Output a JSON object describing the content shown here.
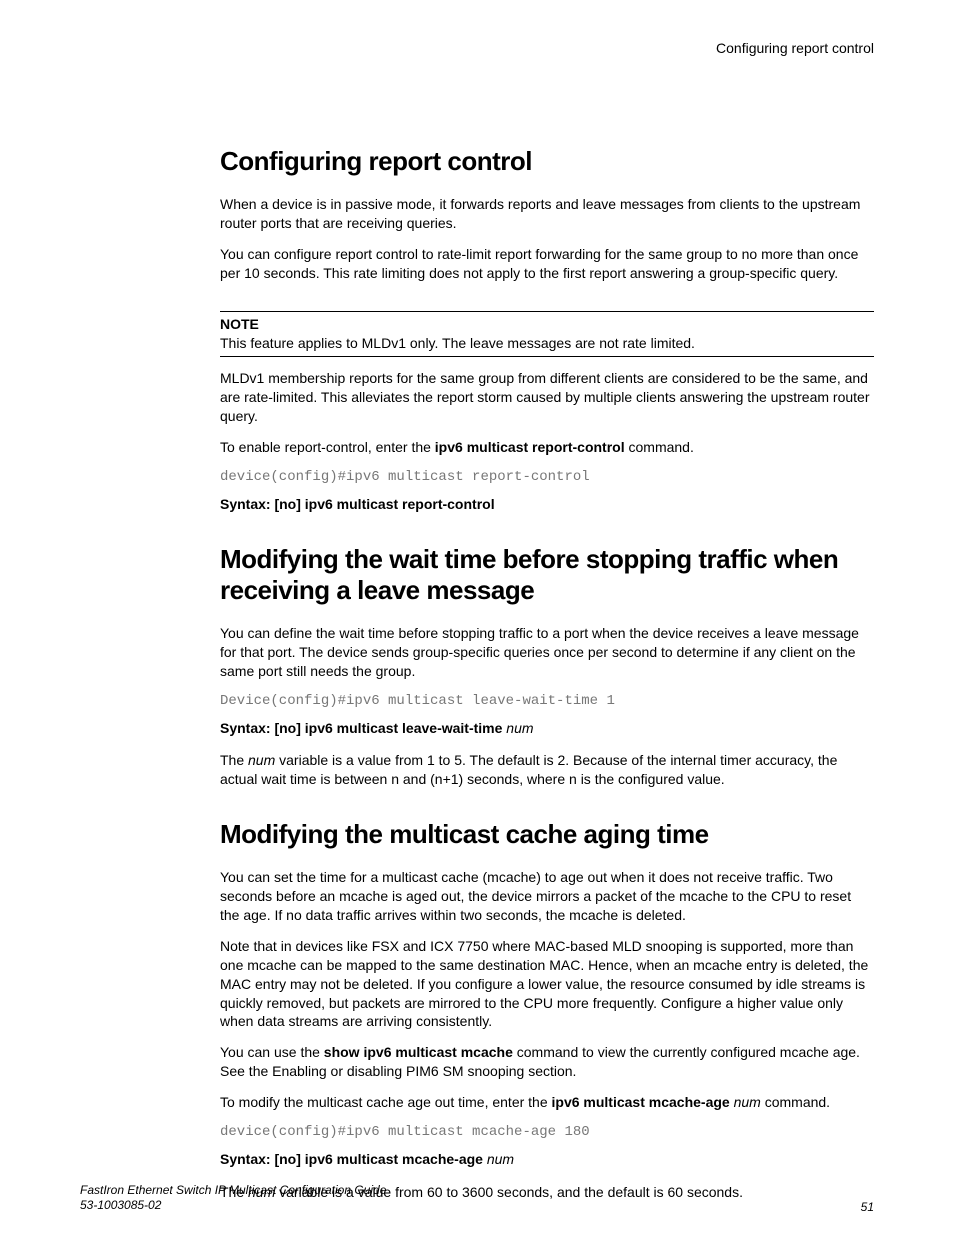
{
  "header": {
    "right": "Configuring report control"
  },
  "section1": {
    "title": "Configuring report control",
    "p1": "When a device is in passive mode, it forwards reports and leave messages from clients to the upstream router ports that are receiving queries.",
    "p2": "You can configure report control to rate-limit report forwarding for the same group to no more than once per 10 seconds. This rate limiting does not apply to the first report answering a group-specific query.",
    "note_label": "NOTE",
    "note_body": "This feature applies to MLDv1 only. The leave messages are not rate limited.",
    "p3": "MLDv1 membership reports for the same group from different clients are considered to be the same, and are rate-limited. This alleviates the report storm caused by multiple clients answering the upstream router query.",
    "p4_pre": "To enable report-control, enter the ",
    "p4_cmd": "ipv6 multicast report-control",
    "p4_post": " command.",
    "code": "device(config)#ipv6 multicast report-control",
    "syntax": "Syntax: [no] ipv6 multicast report-control"
  },
  "section2": {
    "title": "Modifying the wait time before stopping traffic when receiving a leave message",
    "p1": "You can define the wait time before stopping traffic to a port when the device receives a leave message for that port. The device sends group-specific queries once per second to determine if any client on the same port still needs the group.",
    "code": "Device(config)#ipv6 multicast leave-wait-time 1",
    "syntax_bold": "Syntax: [no] ipv6 multicast leave-wait-time ",
    "syntax_italic": "num",
    "p2_1": "The ",
    "p2_num": "num",
    "p2_2": " variable is a value from 1 to 5. The default is 2. Because of the internal timer accuracy, the actual wait time is between n and (n+1) seconds, where n is the configured value."
  },
  "section3": {
    "title": "Modifying the multicast cache aging time",
    "p1": "You can set the time for a multicast cache (mcache) to age out when it does not receive traffic. Two seconds before an mcache is aged out, the device mirrors a packet of the mcache to the CPU to reset the age. If no data traffic arrives within two seconds, the mcache is deleted.",
    "p2": "Note that in devices like FSX and ICX 7750 where MAC-based MLD snooping is supported, more than one mcache can be mapped to the same destination MAC. Hence, when an mcache entry is deleted, the MAC entry may not be deleted. If you configure a lower value, the resource consumed by idle streams is quickly removed, but packets are mirrored to the CPU more frequently. Configure a higher value only when data streams are arriving consistently.",
    "p3_1": "You can use the ",
    "p3_cmd": "show ipv6 multicast mcache",
    "p3_2": " command to view the currently configured mcache age. See the Enabling or disabling PIM6 SM snooping section.",
    "p4_1": "To modify the multicast cache age out time, enter the ",
    "p4_cmd": "ipv6 multicast mcache-age",
    "p4_2": " ",
    "p4_num": "num",
    "p4_3": " command.",
    "code": "device(config)#ipv6 multicast mcache-age 180",
    "syntax_bold": "Syntax: [no] ipv6 multicast mcache-age ",
    "syntax_italic": "num",
    "p5_1": "The ",
    "p5_num": "num",
    "p5_2": " variable is a value from 60 to 3600 seconds, and the default is 60 seconds."
  },
  "footer": {
    "title": "FastIron Ethernet Switch IP Multicast Configuration Guide",
    "docnum": "53-1003085-02",
    "page": "51"
  }
}
